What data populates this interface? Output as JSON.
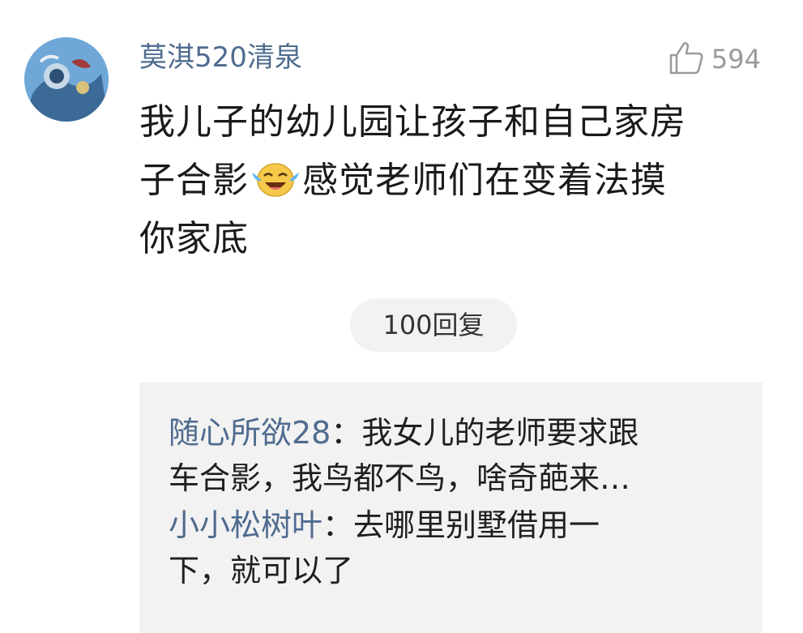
{
  "comment": {
    "username": "莫淇520清泉",
    "like_count": "594",
    "text_line1": "我儿子的幼儿园让孩子和自己家房",
    "text_line2_before": "子合影",
    "text_line2_after": "感觉老师们在变着法摸",
    "text_line3": "你家底",
    "reply_button_label": "100回复"
  },
  "replies": [
    {
      "author": "随心所欲28",
      "separator": "：",
      "text_line1": "我女儿的老师要求跟",
      "text_line2": "车合影，我鸟都不鸟，啥奇葩来…"
    },
    {
      "author": "小小松树叶",
      "separator": "：",
      "text_line1": "去哪里别墅借用一",
      "text_line2": "下，就可以了"
    }
  ],
  "icons": {
    "like": "thumbs-up-icon",
    "emoji": "laughing-crying-emoji-icon",
    "avatar": "user-avatar"
  },
  "colors": {
    "username": "#4f6b8f",
    "body_text": "#1a1a1a",
    "muted": "#9a9a9a",
    "reply_bg": "#f2f2f2"
  }
}
